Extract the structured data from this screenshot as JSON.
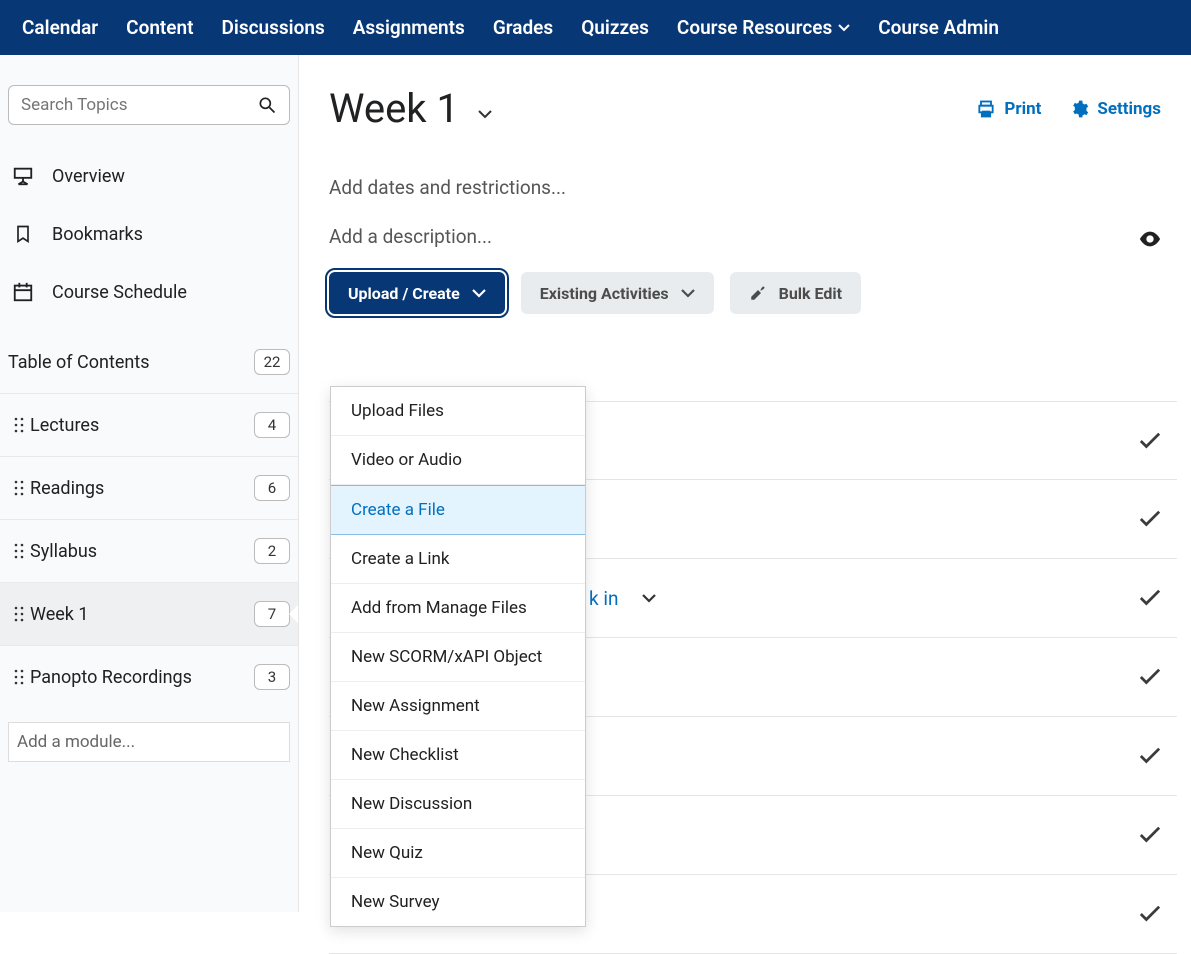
{
  "nav": {
    "items": [
      {
        "label": "Calendar"
      },
      {
        "label": "Content"
      },
      {
        "label": "Discussions"
      },
      {
        "label": "Assignments"
      },
      {
        "label": "Grades"
      },
      {
        "label": "Quizzes"
      },
      {
        "label": "Course Resources",
        "hasMenu": true
      },
      {
        "label": "Course Admin"
      }
    ]
  },
  "sidebar": {
    "search_placeholder": "Search Topics",
    "links": [
      {
        "label": "Overview",
        "icon": "projector"
      },
      {
        "label": "Bookmarks",
        "icon": "bookmark"
      },
      {
        "label": "Course Schedule",
        "icon": "calendar"
      }
    ],
    "toc_title": "Table of Contents",
    "toc_count": "22",
    "toc_items": [
      {
        "label": "Lectures",
        "count": "4"
      },
      {
        "label": "Readings",
        "count": "6"
      },
      {
        "label": "Syllabus",
        "count": "2"
      },
      {
        "label": "Week 1",
        "count": "7",
        "active": true
      },
      {
        "label": "Panopto Recordings",
        "count": "3"
      }
    ],
    "add_module_placeholder": "Add a module..."
  },
  "header": {
    "title": "Week 1",
    "print": "Print",
    "settings": "Settings"
  },
  "placeholders": {
    "dates": "Add dates and restrictions...",
    "description": "Add a description..."
  },
  "toolbar": {
    "upload_create": "Upload / Create",
    "existing": "Existing Activities",
    "bulk_edit": "Bulk Edit"
  },
  "menu": {
    "items": [
      {
        "label": "Upload Files"
      },
      {
        "label": "Video or Audio"
      },
      {
        "label": "Create a File",
        "highlight": true
      },
      {
        "label": "Create a Link"
      },
      {
        "label": "Add from Manage Files"
      },
      {
        "label": "New SCORM/xAPI Object"
      },
      {
        "label": "New Assignment"
      },
      {
        "label": "New Checklist"
      },
      {
        "label": "New Discussion"
      },
      {
        "label": "New Quiz"
      },
      {
        "label": "New Survey"
      }
    ]
  },
  "visible_row_fragment": "k in",
  "colors": {
    "brand": "#083776",
    "link": "#006fbf"
  }
}
